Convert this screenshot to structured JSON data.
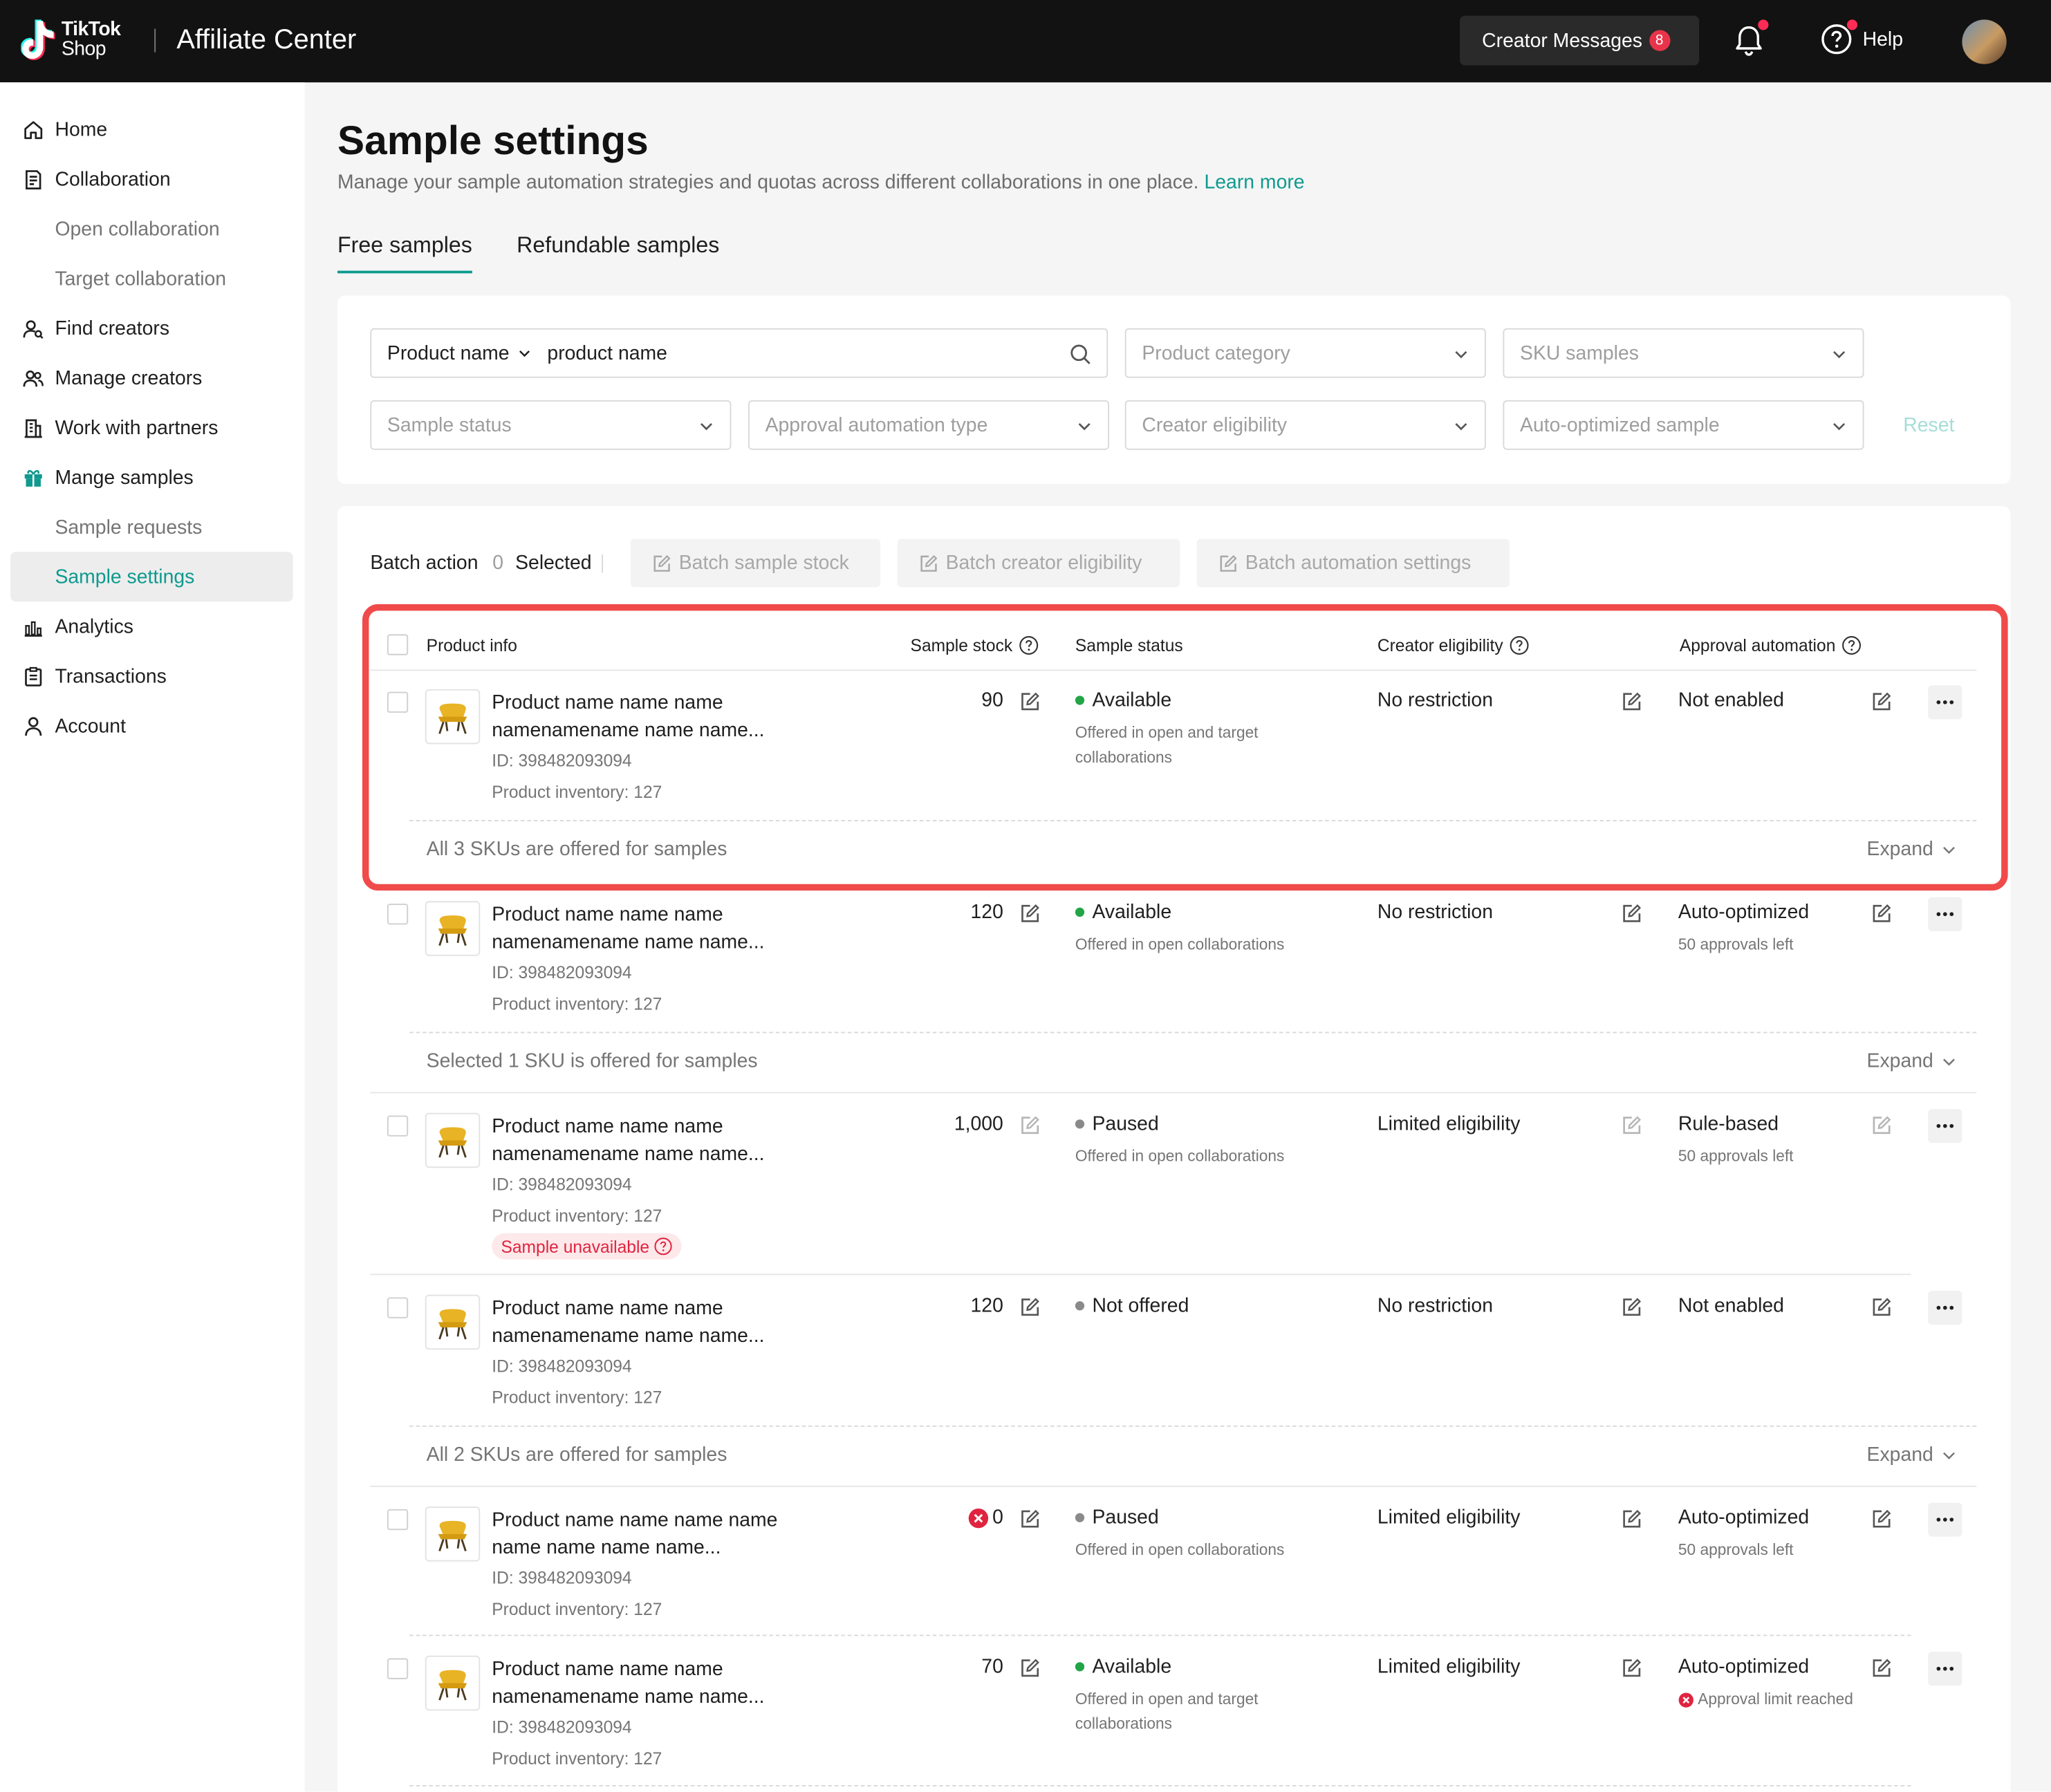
{
  "header": {
    "logo_top": "TikTok",
    "logo_bottom": "Shop",
    "app_title": "Affiliate Center",
    "messages_label": "Creator Messages",
    "messages_count": "8",
    "help_label": "Help"
  },
  "sidebar": {
    "items": [
      {
        "label": "Home",
        "icon": "home-icon"
      },
      {
        "label": "Collaboration",
        "icon": "document-icon"
      },
      {
        "label": "Open collaboration"
      },
      {
        "label": "Target collaboration"
      },
      {
        "label": "Find creators",
        "icon": "user-search-icon"
      },
      {
        "label": "Manage creators",
        "icon": "users-icon"
      },
      {
        "label": "Work with partners",
        "icon": "building-icon"
      },
      {
        "label": "Mange samples",
        "icon": "gift-icon"
      },
      {
        "label": "Sample requests"
      },
      {
        "label": "Sample settings",
        "active": true
      },
      {
        "label": "Analytics",
        "icon": "bar-chart-icon"
      },
      {
        "label": "Transactions",
        "icon": "clipboard-icon"
      },
      {
        "label": "Account",
        "icon": "user-icon"
      }
    ]
  },
  "page": {
    "title": "Sample settings",
    "description": "Manage your sample automation strategies and quotas across different collaborations in one place.",
    "learn_more": "Learn more",
    "tabs": [
      "Free samples",
      "Refundable samples"
    ]
  },
  "filters": {
    "search_field_type": "Product name",
    "search_value": "product name",
    "product_category": "Product category",
    "sku_samples": "SKU samples",
    "sample_status": "Sample status",
    "approval_type": "Approval automation type",
    "creator_eligibility": "Creator eligibility",
    "auto_optimized": "Auto-optimized sample",
    "reset": "Reset"
  },
  "batch": {
    "label": "Batch action",
    "count": "0",
    "selected": "Selected",
    "btn_stock": "Batch sample stock",
    "btn_eligibility": "Batch creator eligibility",
    "btn_automation": "Batch automation settings"
  },
  "table": {
    "headers": {
      "product": "Product info",
      "stock": "Sample stock",
      "status": "Sample status",
      "eligibility": "Creator eligibility",
      "approval": "Approval automation"
    },
    "rows": [
      {
        "name": "Product name name name namenamename name name...",
        "id": "ID: 398482093094",
        "inventory": "Product inventory: 127",
        "stock": "90",
        "status": "Available",
        "status_color": "#22a447",
        "status_sub": "Offered in open and target collaborations",
        "eligibility": "No restriction",
        "approval": "Not enabled",
        "approval_sub": "",
        "sku_text": "All 3 SKUs are offered for samples",
        "expand": "Expand"
      },
      {
        "name": "Product name name name namenamename name name...",
        "id": "ID: 398482093094",
        "inventory": "Product inventory: 127",
        "stock": "120",
        "status": "Available",
        "status_color": "#22a447",
        "status_sub": "Offered in open collaborations",
        "eligibility": "No restriction",
        "approval": "Auto-optimized",
        "approval_sub": "50 approvals left",
        "sku_text": "Selected 1 SKU is offered for samples",
        "expand": "Expand"
      },
      {
        "name": "Product name name name namenamename name name...",
        "id": "ID: 398482093094",
        "inventory": "Product inventory: 127",
        "tag": "Sample unavailable",
        "stock": "1,000",
        "status": "Paused",
        "status_color": "#8a8a8a",
        "status_sub": "Offered in open collaborations",
        "eligibility": "Limited eligibility",
        "approval": "Rule-based",
        "approval_sub": "50 approvals left"
      },
      {
        "name": "Product name name name namenamename name name...",
        "id": "ID: 398482093094",
        "inventory": "Product inventory: 127",
        "stock": "120",
        "status": "Not offered",
        "status_color": "#8a8a8a",
        "status_sub": "",
        "eligibility": "No restriction",
        "approval": "Not enabled",
        "approval_sub": "",
        "sku_text": "All 2 SKUs are offered for samples",
        "expand": "Expand"
      },
      {
        "name": "Product name name name name name name name name...",
        "id": "ID: 398482093094",
        "inventory": "Product inventory: 127",
        "stock": "0",
        "stock_error": true,
        "status": "Paused",
        "status_color": "#8a8a8a",
        "status_sub": "Offered in open collaborations",
        "eligibility": "Limited eligibility",
        "approval": "Auto-optimized",
        "approval_sub": "50 approvals left"
      },
      {
        "name": "Product name name name namenamename name name...",
        "id": "ID: 398482093094",
        "inventory": "Product inventory: 127",
        "stock": "70",
        "status": "Available",
        "status_color": "#22a447",
        "status_sub": "Offered in open and target collaborations",
        "eligibility": "Limited eligibility",
        "approval": "Auto-optimized",
        "approval_sub": "Approval limit reached",
        "approval_sub_error": true
      }
    ]
  },
  "colors": {
    "accent": "#0e9a8f",
    "highlight": "#f04a4a",
    "available": "#22a447",
    "error": "#e0243f"
  }
}
